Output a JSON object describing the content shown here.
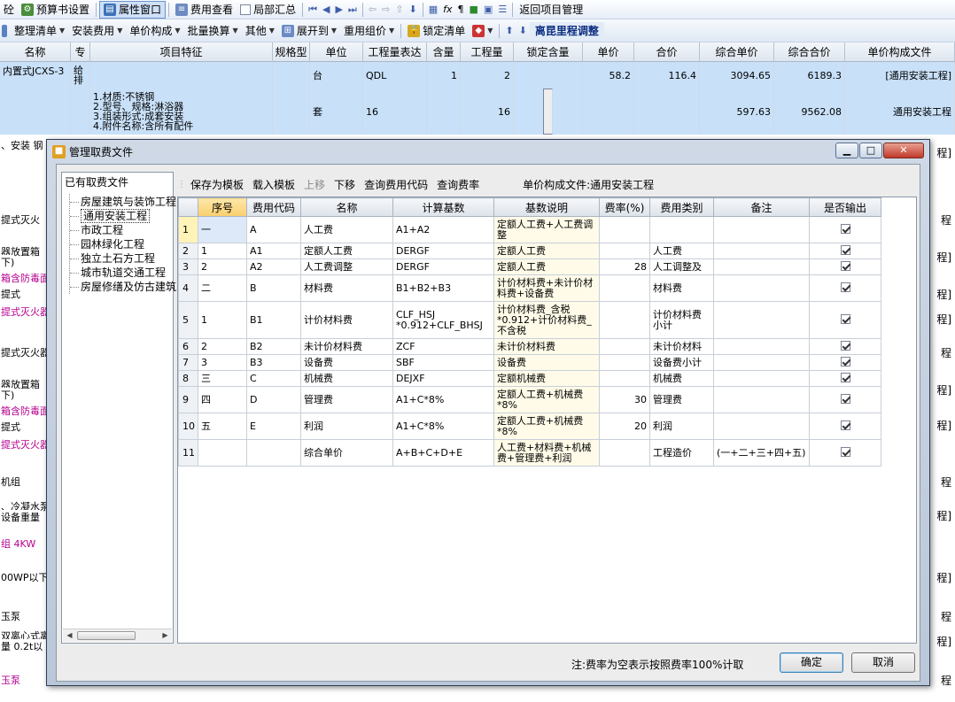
{
  "toolbar1": {
    "items": [
      "砼",
      "预算书设置",
      "属性窗口",
      "费用查看",
      "局部汇总",
      "返回项目管理"
    ]
  },
  "toolbar2": {
    "items": [
      "整理清单",
      "安装费用",
      "单价构成",
      "批量换算",
      "其他",
      "展开到",
      "重用组价",
      "锁定清单",
      "离昆里程调整"
    ]
  },
  "grid": {
    "headers": [
      "名称",
      "专",
      "项目特征",
      "规格型",
      "单位",
      "工程量表达",
      "含量",
      "工程量",
      "锁定含量",
      "单价",
      "合价",
      "综合单价",
      "综合合价",
      "单价构成文件"
    ],
    "rows": [
      {
        "name": "内置式JCXS-3",
        "zhuan": "给排",
        "tezheng": "",
        "unit": "台",
        "expr": "QDL",
        "hl": "1",
        "gcl": "2",
        "dj": "58.2",
        "hj": "116.4",
        "zhdj": "3094.65",
        "zhhj": "6189.3",
        "file": "[通用安装工程]"
      },
      {
        "name": "",
        "zhuan": "",
        "tezheng": "1.材质:不锈钢\n2.型号、规格:淋浴器\n3.组装形式:成套安装\n4.附件名称:含所有配件",
        "unit": "套",
        "expr": "16",
        "hl": "",
        "gcl": "16",
        "dj": "",
        "hj": "",
        "zhdj": "597.63",
        "zhhj": "9562.08",
        "file": "通用安装工程"
      }
    ],
    "left_labels": [
      {
        "text": "、安装 钢",
        "cls": ""
      },
      {
        "text": "提式灭火",
        "cls": ""
      },
      {
        "text": "器放置箱",
        "cls": ""
      },
      {
        "text": "下)",
        "cls": ""
      },
      {
        "text": "箱含防毒面",
        "cls": "mag"
      },
      {
        "text": "提式",
        "cls": ""
      },
      {
        "text": "提式灭火器",
        "cls": "mag"
      },
      {
        "text": "提式灭火器",
        "cls": ""
      },
      {
        "text": "器放置箱",
        "cls": ""
      },
      {
        "text": "下)",
        "cls": ""
      },
      {
        "text": "箱含防毒面",
        "cls": "mag"
      },
      {
        "text": "提式",
        "cls": ""
      },
      {
        "text": "提式灭火器",
        "cls": "mag"
      },
      {
        "text": "机组",
        "cls": ""
      },
      {
        "text": "、冷凝水泵",
        "cls": ""
      },
      {
        "text": "设备重量",
        "cls": ""
      },
      {
        "text": "组 4KW",
        "cls": "mag"
      },
      {
        "text": "00WP以下",
        "cls": ""
      },
      {
        "text": "玉泵",
        "cls": ""
      },
      {
        "text": "双离心式离",
        "cls": ""
      },
      {
        "text": "量 0.2t以",
        "cls": ""
      },
      {
        "text": "玉泵",
        "cls": "mag"
      }
    ],
    "right_labels": [
      "程]",
      "程",
      "程]",
      "程]",
      "程]",
      "程",
      "程]",
      "程]",
      "程",
      "程]",
      "程]",
      "程",
      "程]",
      "程"
    ]
  },
  "dialog": {
    "title": "管理取费文件",
    "tree_header": "已有取费文件",
    "tree_items": [
      "房屋建筑与装饰工程",
      "通用安装工程",
      "市政工程",
      "园林绿化工程",
      "独立土石方工程",
      "城市轨道交通工程",
      "房屋修缮及仿古建筑"
    ],
    "toolbar": {
      "save_template": "保存为模板",
      "load_template": "载入模板",
      "move_up": "上移",
      "move_down": "下移",
      "query_code": "查询费用代码",
      "query_rate": "查询费率",
      "file_label": "单价构成文件:通用安装工程"
    },
    "table": {
      "headers": [
        "",
        "序号",
        "费用代码",
        "名称",
        "计算基数",
        "基数说明",
        "费率(%)",
        "费用类别",
        "备注",
        "是否输出"
      ],
      "rows": [
        {
          "rn": "1",
          "xh": "一",
          "code": "A",
          "name": "人工费",
          "base": "A1+A2",
          "desc": "定额人工费+人工费调整",
          "rate": "",
          "cat": "",
          "note": "",
          "out": true
        },
        {
          "rn": "2",
          "xh": "1",
          "code": "A1",
          "name": "定额人工费",
          "base": "DERGF",
          "desc": "定额人工费",
          "rate": "",
          "cat": "人工费",
          "note": "",
          "out": true
        },
        {
          "rn": "3",
          "xh": "2",
          "code": "A2",
          "name": "人工费调整",
          "base": "DERGF",
          "desc": "定额人工费",
          "rate": "28",
          "cat": "人工调整及",
          "note": "",
          "out": true
        },
        {
          "rn": "4",
          "xh": "二",
          "code": "B",
          "name": "材料费",
          "base": "B1+B2+B3",
          "desc": "计价材料费+未计价材料费+设备费",
          "rate": "",
          "cat": "材料费",
          "note": "",
          "out": true
        },
        {
          "rn": "5",
          "xh": "1",
          "code": "B1",
          "name": "计价材料费",
          "base": "CLF_HSJ *0.912+CLF_BHSJ",
          "desc": "计价材料费_含税*0.912+计价材料费_不含税",
          "rate": "",
          "cat": "计价材料费小计",
          "note": "",
          "out": true
        },
        {
          "rn": "6",
          "xh": "2",
          "code": "B2",
          "name": "未计价材料费",
          "base": "ZCF",
          "desc": "未计价材料费",
          "rate": "",
          "cat": "未计价材料",
          "note": "",
          "out": true
        },
        {
          "rn": "7",
          "xh": "3",
          "code": "B3",
          "name": "设备费",
          "base": "SBF",
          "desc": "设备费",
          "rate": "",
          "cat": "设备费小计",
          "note": "",
          "out": true
        },
        {
          "rn": "8",
          "xh": "三",
          "code": "C",
          "name": "机械费",
          "base": "DEJXF",
          "desc": "定额机械费",
          "rate": "",
          "cat": "机械费",
          "note": "",
          "out": true
        },
        {
          "rn": "9",
          "xh": "四",
          "code": "D",
          "name": "管理费",
          "base": "A1+C*8%",
          "desc": "定额人工费+机械费*8%",
          "rate": "30",
          "cat": "管理费",
          "note": "",
          "out": true
        },
        {
          "rn": "10",
          "xh": "五",
          "code": "E",
          "name": "利润",
          "base": "A1+C*8%",
          "desc": "定额人工费+机械费*8%",
          "rate": "20",
          "cat": "利润",
          "note": "",
          "out": true
        },
        {
          "rn": "11",
          "xh": "",
          "code": "",
          "name": "综合单价",
          "base": "A+B+C+D+E",
          "desc": "人工费+材料费+机械费+管理费+利润",
          "rate": "",
          "cat": "工程造价",
          "note": "(一+二+三+四+五)",
          "out": true
        }
      ]
    },
    "footer": {
      "note": "注:费率为空表示按照费率100%计取",
      "ok": "确定",
      "cancel": "取消"
    }
  }
}
